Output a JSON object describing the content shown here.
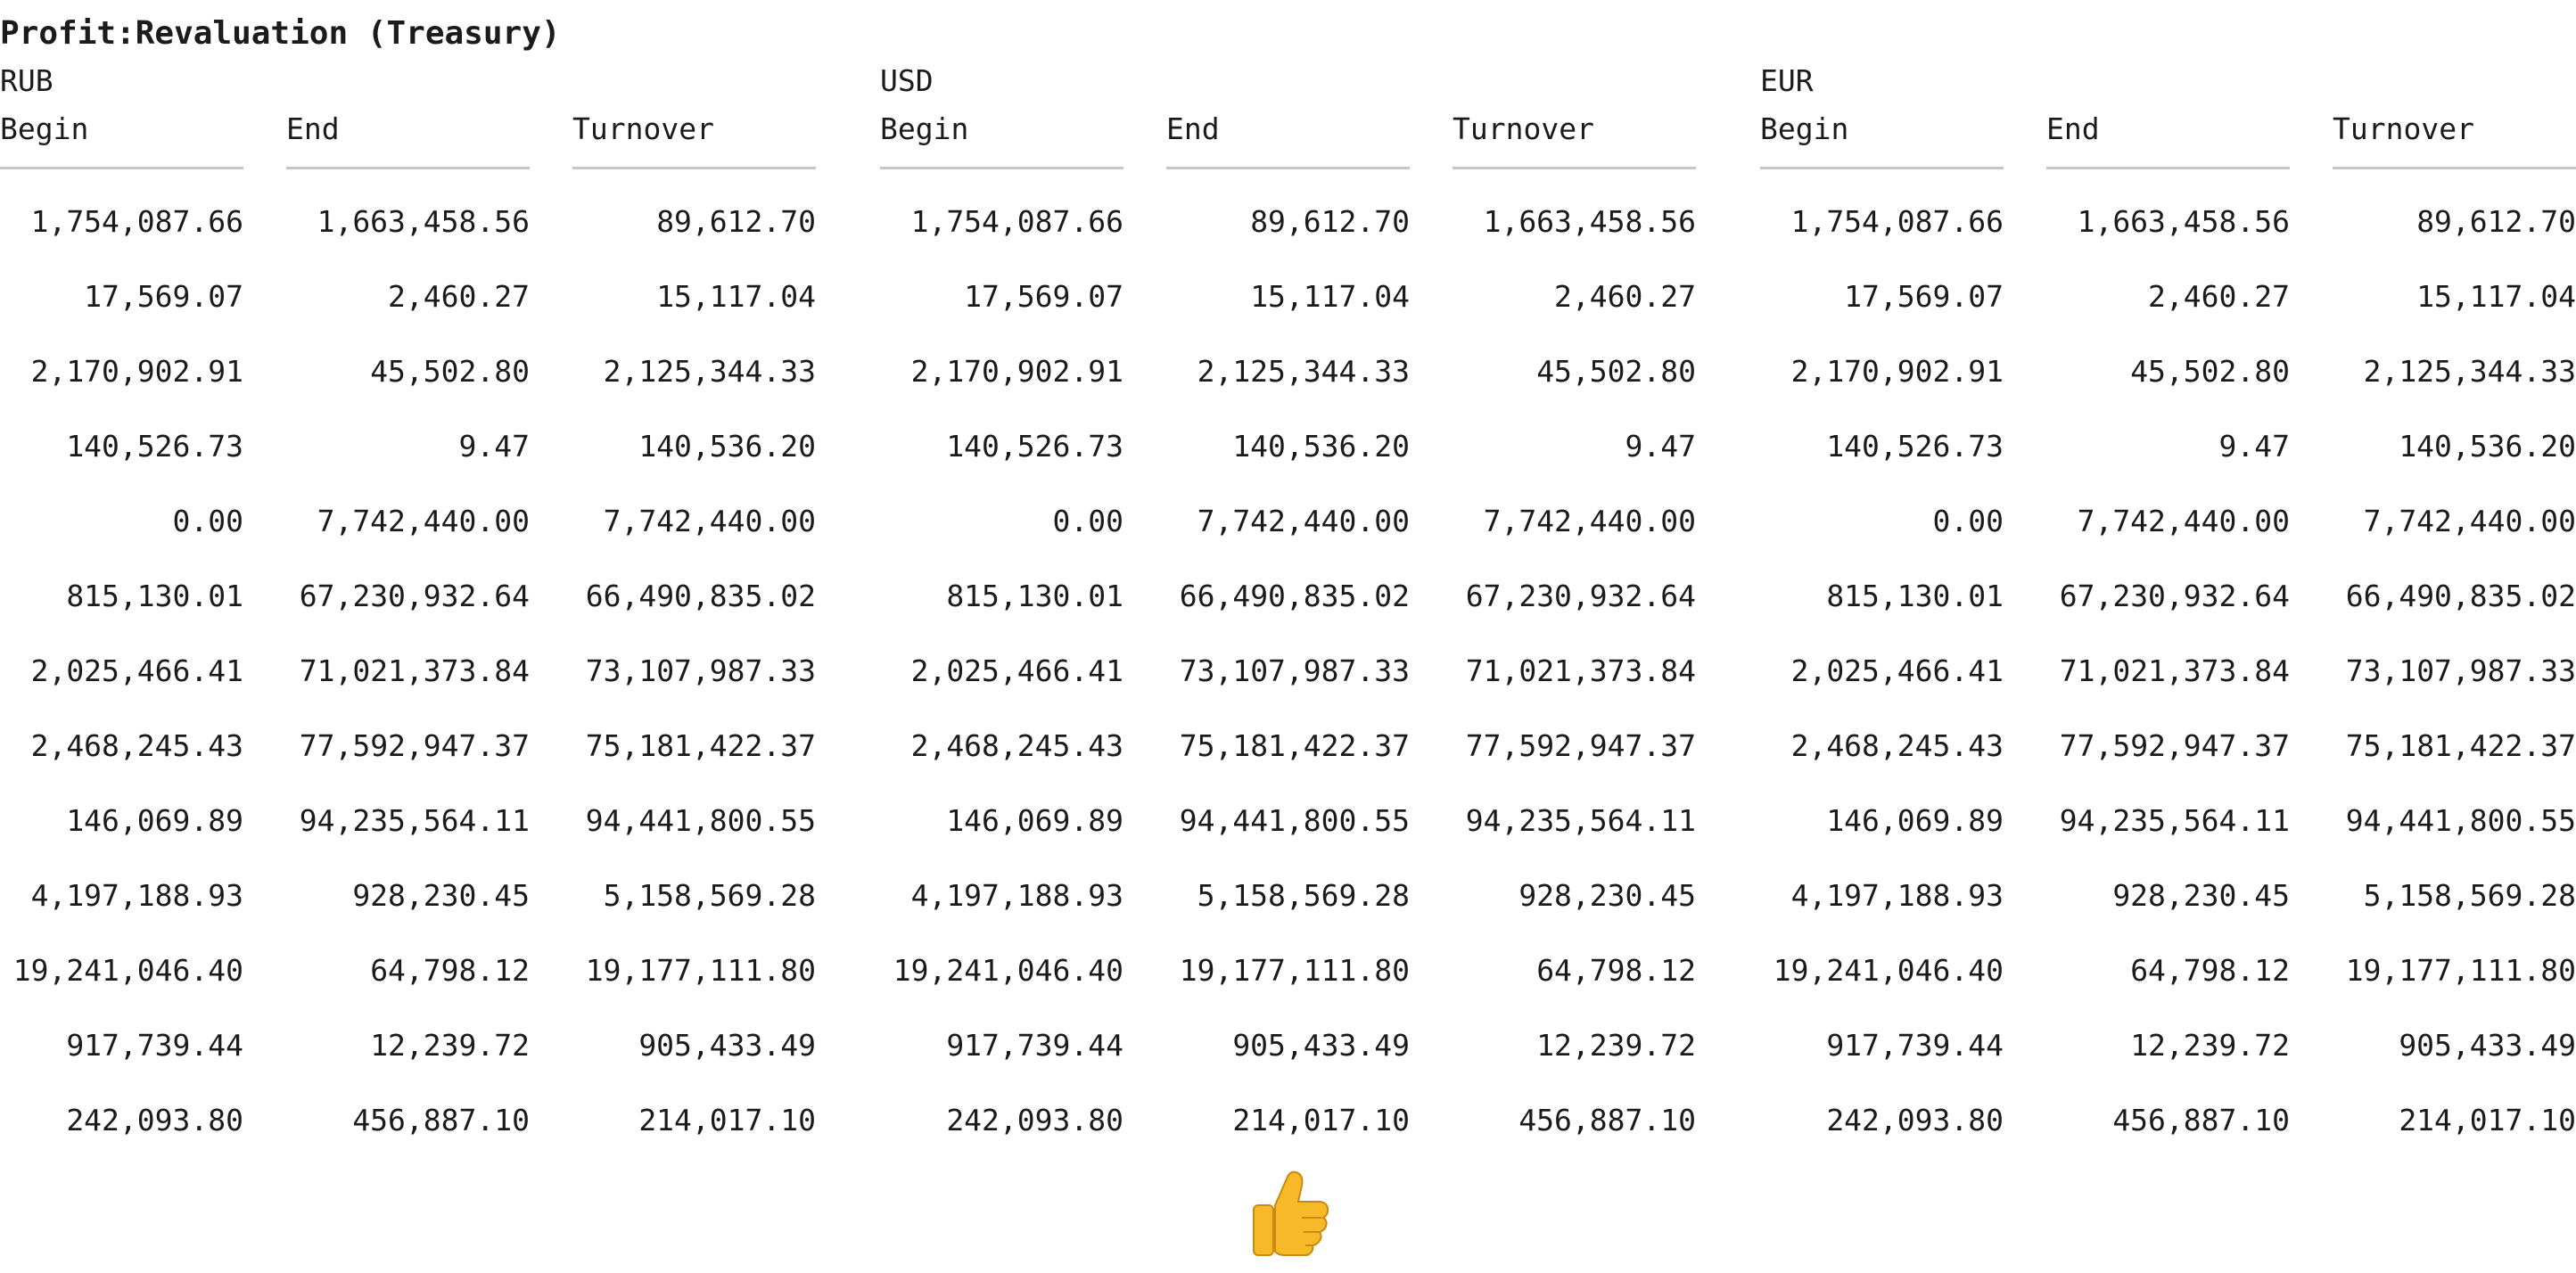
{
  "title": "Profit:Revaluation (Treasury)",
  "currencies": [
    "RUB",
    "USD",
    "EUR"
  ],
  "column_headers": [
    "Begin",
    "End",
    "Turnover"
  ],
  "rows": [
    [
      [
        "1,754,087.66",
        "1,663,458.56",
        "89,612.70"
      ],
      [
        "1,754,087.66",
        "89,612.70",
        "1,663,458.56"
      ],
      [
        "1,754,087.66",
        "1,663,458.56",
        "89,612.70"
      ]
    ],
    [
      [
        "17,569.07",
        "2,460.27",
        "15,117.04"
      ],
      [
        "17,569.07",
        "15,117.04",
        "2,460.27"
      ],
      [
        "17,569.07",
        "2,460.27",
        "15,117.04"
      ]
    ],
    [
      [
        "2,170,902.91",
        "45,502.80",
        "2,125,344.33"
      ],
      [
        "2,170,902.91",
        "2,125,344.33",
        "45,502.80"
      ],
      [
        "2,170,902.91",
        "45,502.80",
        "2,125,344.33"
      ]
    ],
    [
      [
        "140,526.73",
        "9.47",
        "140,536.20"
      ],
      [
        "140,526.73",
        "140,536.20",
        "9.47"
      ],
      [
        "140,526.73",
        "9.47",
        "140,536.20"
      ]
    ],
    [
      [
        "0.00",
        "7,742,440.00",
        "7,742,440.00"
      ],
      [
        "0.00",
        "7,742,440.00",
        "7,742,440.00"
      ],
      [
        "0.00",
        "7,742,440.00",
        "7,742,440.00"
      ]
    ],
    [
      [
        "815,130.01",
        "67,230,932.64",
        "66,490,835.02"
      ],
      [
        "815,130.01",
        "66,490,835.02",
        "67,230,932.64"
      ],
      [
        "815,130.01",
        "67,230,932.64",
        "66,490,835.02"
      ]
    ],
    [
      [
        "2,025,466.41",
        "71,021,373.84",
        "73,107,987.33"
      ],
      [
        "2,025,466.41",
        "73,107,987.33",
        "71,021,373.84"
      ],
      [
        "2,025,466.41",
        "71,021,373.84",
        "73,107,987.33"
      ]
    ],
    [
      [
        "2,468,245.43",
        "77,592,947.37",
        "75,181,422.37"
      ],
      [
        "2,468,245.43",
        "75,181,422.37",
        "77,592,947.37"
      ],
      [
        "2,468,245.43",
        "77,592,947.37",
        "75,181,422.37"
      ]
    ],
    [
      [
        "146,069.89",
        "94,235,564.11",
        "94,441,800.55"
      ],
      [
        "146,069.89",
        "94,441,800.55",
        "94,235,564.11"
      ],
      [
        "146,069.89",
        "94,235,564.11",
        "94,441,800.55"
      ]
    ],
    [
      [
        "4,197,188.93",
        "928,230.45",
        "5,158,569.28"
      ],
      [
        "4,197,188.93",
        "5,158,569.28",
        "928,230.45"
      ],
      [
        "4,197,188.93",
        "928,230.45",
        "5,158,569.28"
      ]
    ],
    [
      [
        "19,241,046.40",
        "64,798.12",
        "19,177,111.80"
      ],
      [
        "19,241,046.40",
        "19,177,111.80",
        "64,798.12"
      ],
      [
        "19,241,046.40",
        "64,798.12",
        "19,177,111.80"
      ]
    ],
    [
      [
        "917,739.44",
        "12,239.72",
        "905,433.49"
      ],
      [
        "917,739.44",
        "905,433.49",
        "12,239.72"
      ],
      [
        "917,739.44",
        "12,239.72",
        "905,433.49"
      ]
    ],
    [
      [
        "242,093.80",
        "456,887.10",
        "214,017.10"
      ],
      [
        "242,093.80",
        "214,017.10",
        "456,887.10"
      ],
      [
        "242,093.80",
        "456,887.10",
        "214,017.10"
      ]
    ]
  ],
  "reaction_icon": "thumbs-up-icon",
  "colors": {
    "text": "#1b1b1b",
    "rule": "#c6c6c6",
    "emoji_fill": "#f7b928"
  }
}
